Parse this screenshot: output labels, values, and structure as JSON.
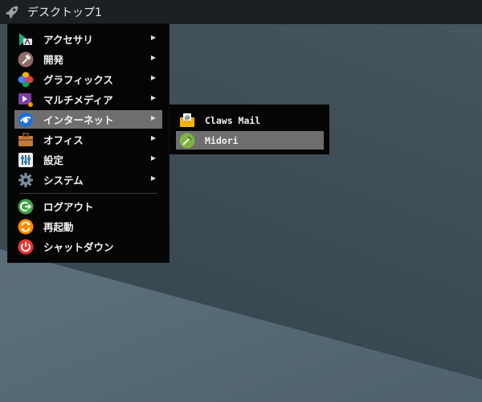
{
  "taskbar": {
    "workspace_label": "デスクトップ1",
    "menu_icon": "rocket-icon"
  },
  "menu": {
    "items": [
      {
        "label": "アクセサリ",
        "icon": "accessories-icon",
        "has_submenu": true
      },
      {
        "label": "開発",
        "icon": "development-icon",
        "has_submenu": true
      },
      {
        "label": "グラフィックス",
        "icon": "graphics-icon",
        "has_submenu": true
      },
      {
        "label": "マルチメディア",
        "icon": "multimedia-icon",
        "has_submenu": true
      },
      {
        "label": "インターネット",
        "icon": "internet-icon",
        "has_submenu": true,
        "selected": true
      },
      {
        "label": "オフィス",
        "icon": "office-icon",
        "has_submenu": true
      },
      {
        "label": "設定",
        "icon": "settings-icon",
        "has_submenu": true
      },
      {
        "label": "システム",
        "icon": "system-icon",
        "has_submenu": true
      }
    ],
    "session_items": [
      {
        "label": "ログアウト",
        "icon": "logout-icon"
      },
      {
        "label": "再起動",
        "icon": "restart-icon"
      },
      {
        "label": "シャットダウン",
        "icon": "shutdown-icon"
      }
    ],
    "arrow_glyph": "▶"
  },
  "submenu": {
    "items": [
      {
        "label": "Claws Mail",
        "icon": "mail-icon"
      },
      {
        "label": "Midori",
        "icon": "midori-browser-icon",
        "selected": true
      }
    ]
  },
  "colors": {
    "menu_bg": "#050505",
    "selection_bg": "#6e6e6e",
    "taskbar_bg": "#1c2024"
  }
}
